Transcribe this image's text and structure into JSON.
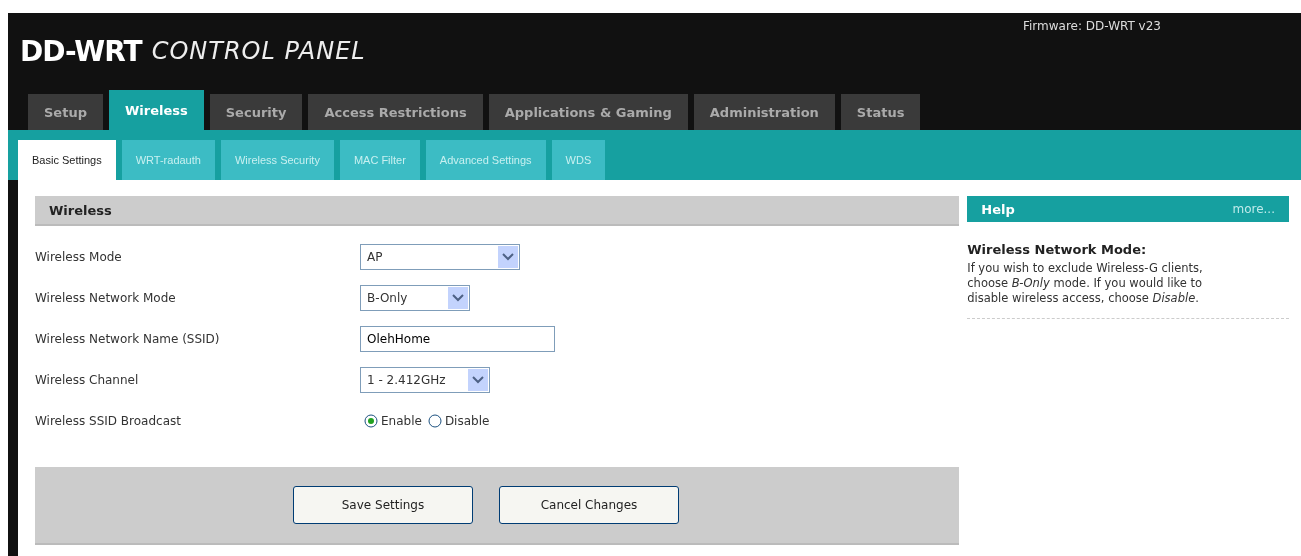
{
  "header": {
    "logo_bold": "DD-WRT",
    "logo_light": "CONTROL PANEL",
    "firmware": "Firmware: DD-WRT v23"
  },
  "tabs": [
    {
      "label": "Setup",
      "selected": false
    },
    {
      "label": "Wireless",
      "selected": true
    },
    {
      "label": "Security",
      "selected": false
    },
    {
      "label": "Access Restrictions",
      "selected": false
    },
    {
      "label": "Applications & Gaming",
      "selected": false
    },
    {
      "label": "Administration",
      "selected": false
    },
    {
      "label": "Status",
      "selected": false
    }
  ],
  "subtabs": [
    {
      "label": "Basic Settings",
      "selected": true
    },
    {
      "label": "WRT-radauth",
      "selected": false
    },
    {
      "label": "Wireless Security",
      "selected": false
    },
    {
      "label": "MAC Filter",
      "selected": false
    },
    {
      "label": "Advanced Settings",
      "selected": false
    },
    {
      "label": "WDS",
      "selected": false
    }
  ],
  "section": {
    "title": "Wireless"
  },
  "fields": [
    {
      "kind": "select",
      "label": "Wireless Mode",
      "value": "AP"
    },
    {
      "kind": "select",
      "label": "Wireless Network Mode",
      "value": "B-Only"
    },
    {
      "kind": "text",
      "label": "Wireless Network Name (SSID)",
      "value": "OlehHome"
    },
    {
      "kind": "select",
      "label": "Wireless Channel",
      "value": "1 - 2.412GHz"
    },
    {
      "kind": "radio",
      "label": "Wireless SSID Broadcast",
      "options": [
        {
          "label": "Enable",
          "selected": true
        },
        {
          "label": "Disable",
          "selected": false
        }
      ]
    }
  ],
  "buttons": [
    "Save Settings",
    "Cancel Changes"
  ],
  "help": {
    "title": "Help",
    "more": "more...",
    "heading": "Wireless Network Mode:",
    "text": "If you wish to exclude Wireless-G clients, choose *B-Only* mode. If you would like to disable wireless access, choose *Disable*."
  }
}
